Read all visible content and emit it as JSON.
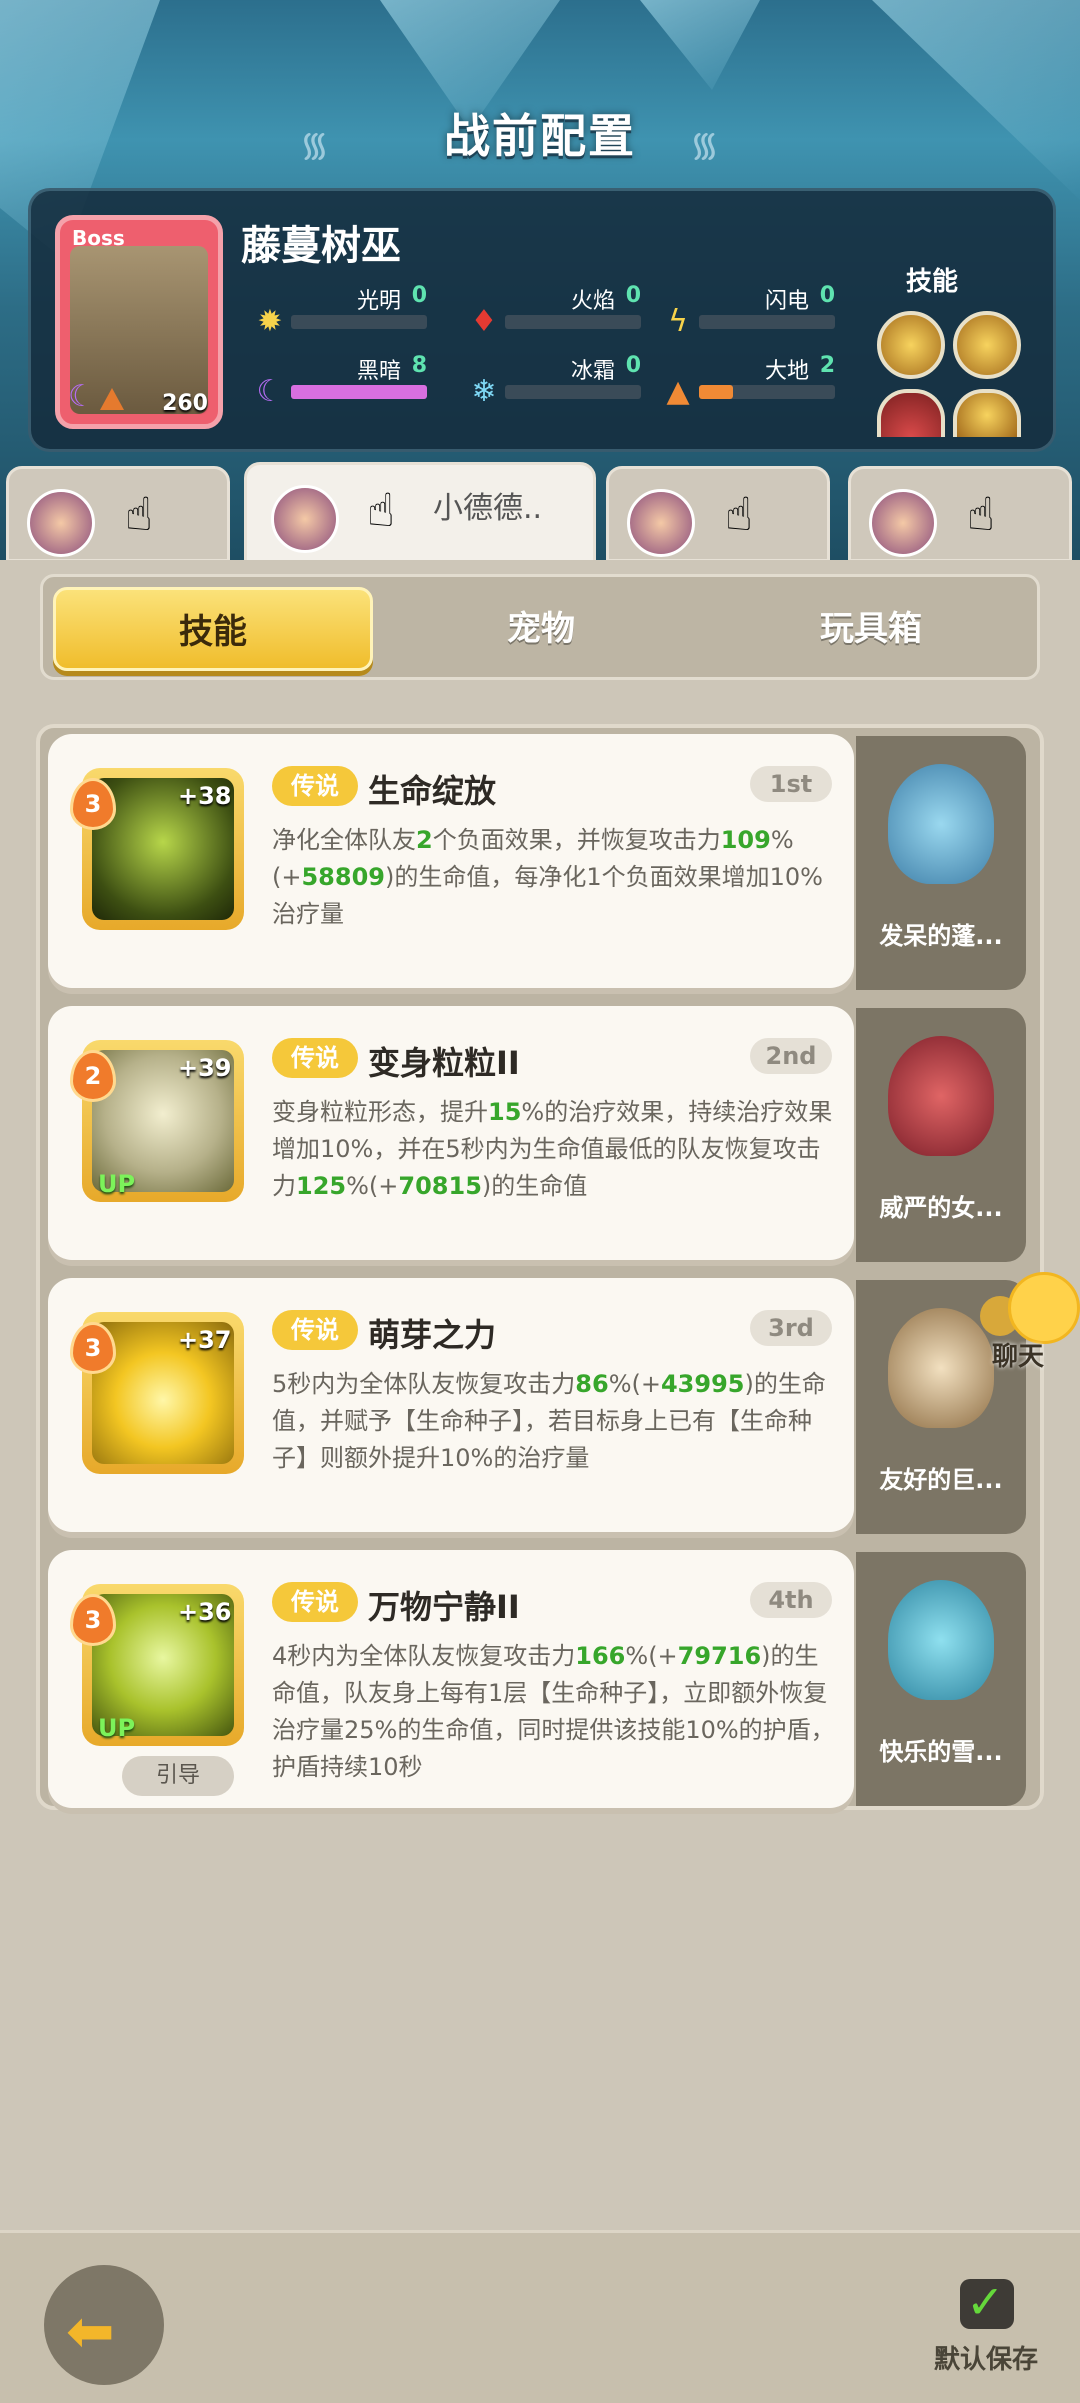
{
  "header": {
    "title": "战前配置"
  },
  "boss": {
    "tag": "Boss",
    "name": "藤蔓树巫",
    "level": "260",
    "skills_label": "技能",
    "elements": [
      {
        "label": "光明",
        "value": "0",
        "fill": 0
      },
      {
        "label": "火焰",
        "value": "0",
        "fill": 0
      },
      {
        "label": "闪电",
        "value": "0",
        "fill": 0
      },
      {
        "label": "黑暗",
        "value": "8",
        "fill": 1
      },
      {
        "label": "冰霜",
        "value": "0",
        "fill": 0
      },
      {
        "label": "大地",
        "value": "2",
        "fill": 0.25
      }
    ]
  },
  "hero_tabs": [
    {
      "name": "",
      "active": false
    },
    {
      "name": "小德德..",
      "active": true
    },
    {
      "name": "",
      "active": false
    },
    {
      "name": "",
      "active": false
    }
  ],
  "segments": {
    "skills": "技能",
    "pets": "宠物",
    "toybox": "玩具箱"
  },
  "skills": [
    {
      "level": "3",
      "plus": "+38",
      "rarity": "传说",
      "name": "生命绽放",
      "rank": "1st",
      "desc": "净化全体队友<span class=\"g\">2</span>个负面效果，并恢复攻击力<span class=\"g\">109</span>%(+<span class=\"g\">58809</span>)的生命值，每净化1个负面效果增加10%治疗量",
      "pet": "发呆的蓬..."
    },
    {
      "level": "2",
      "plus": "+39",
      "rarity": "传说",
      "name": "变身粒粒II",
      "rank": "2nd",
      "up": "UP",
      "desc": "变身粒粒形态，提升<span class=\"g\">15</span>%的治疗效果，持续治疗效果增加10%，并在5秒内为生命值最低的队友恢复攻击力<span class=\"g\">125</span>%(+<span class=\"g\">70815</span>)的生命值",
      "pet": "威严的女..."
    },
    {
      "level": "3",
      "plus": "+37",
      "rarity": "传说",
      "name": "萌芽之力",
      "rank": "3rd",
      "desc": "5秒内为全体队友恢复攻击力<span class=\"g\">86</span>%(+<span class=\"g\">43995</span>)的生命值，并赋予【生命种子】，若目标身上已有【生命种子】则额外提升10%的治疗量",
      "pet": "友好的巨..."
    },
    {
      "level": "3",
      "plus": "+36",
      "rarity": "传说",
      "name": "万物宁静II",
      "rank": "4th",
      "up": "UP",
      "guide": "引导",
      "desc": "4秒内为全体队友恢复攻击力<span class=\"g\">166</span>%(+<span class=\"g\">79716</span>)的生命值，队友身上每有1层【生命种子】，立即额外恢复治疗量25%的生命值，同时提供该技能10%的护盾，护盾持续10秒",
      "pet": "快乐的雪..."
    }
  ],
  "chat": {
    "label": "聊天"
  },
  "footer": {
    "save_label": "默认保存",
    "back_icon": "back-arrow-icon"
  }
}
